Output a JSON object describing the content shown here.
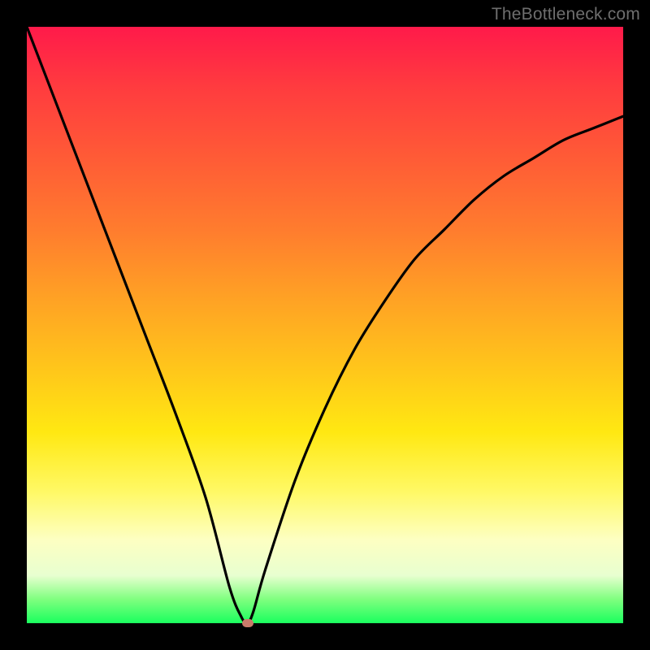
{
  "watermark": "TheBottleneck.com",
  "chart_data": {
    "type": "line",
    "title": "",
    "xlabel": "",
    "ylabel": "",
    "xlim": [
      0,
      100
    ],
    "ylim": [
      0,
      100
    ],
    "grid": false,
    "legend": false,
    "series": [
      {
        "name": "bottleneck-curve",
        "x": [
          0,
          5,
          10,
          15,
          20,
          25,
          30,
          34,
          36,
          37,
          38,
          40,
          45,
          50,
          55,
          60,
          65,
          70,
          75,
          80,
          85,
          90,
          95,
          100
        ],
        "values": [
          100,
          87,
          74,
          61,
          48,
          35,
          21,
          6,
          1,
          0,
          2,
          9,
          24,
          36,
          46,
          54,
          61,
          66,
          71,
          75,
          78,
          81,
          83,
          85
        ]
      }
    ],
    "marker": {
      "x": 37,
      "y": 0
    },
    "background_gradient": {
      "top": "#ff1a4a",
      "bottom": "#1aff5e"
    }
  }
}
